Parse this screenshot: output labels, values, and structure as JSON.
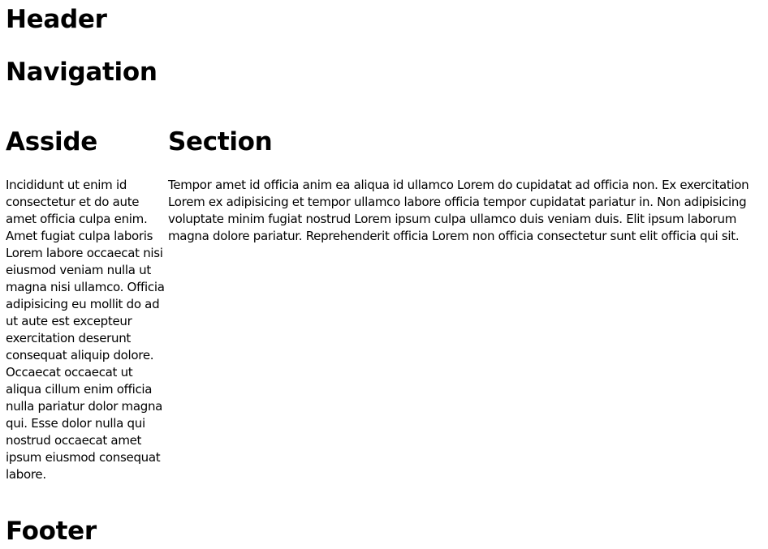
{
  "header": {
    "title": "Header"
  },
  "nav": {
    "title": "Navigation"
  },
  "aside": {
    "title": "Asside",
    "text": "Incididunt ut enim id consectetur et do aute amet officia culpa enim. Amet fugiat culpa laboris Lorem labore occaecat nisi eiusmod veniam nulla ut magna nisi ullamco. Officia adipisicing eu mollit do ad ut aute est excepteur exercitation deserunt consequat aliquip dolore. Occaecat occaecat ut aliqua cillum enim officia nulla pariatur dolor magna qui. Esse dolor nulla qui nostrud occaecat amet ipsum eiusmod consequat labore."
  },
  "section": {
    "title": "Section",
    "text": "Tempor amet id officia anim ea aliqua id ullamco Lorem do cupidatat ad officia non. Ex exercitation Lorem ex adipisicing et tempor ullamco labore officia tempor cupidatat pariatur in. Non adipisicing voluptate minim fugiat nostrud Lorem ipsum culpa ullamco duis veniam duis. Elit ipsum laborum magna dolore pariatur. Reprehenderit officia Lorem non officia consectetur sunt elit officia qui sit."
  },
  "footer": {
    "title": "Footer"
  }
}
